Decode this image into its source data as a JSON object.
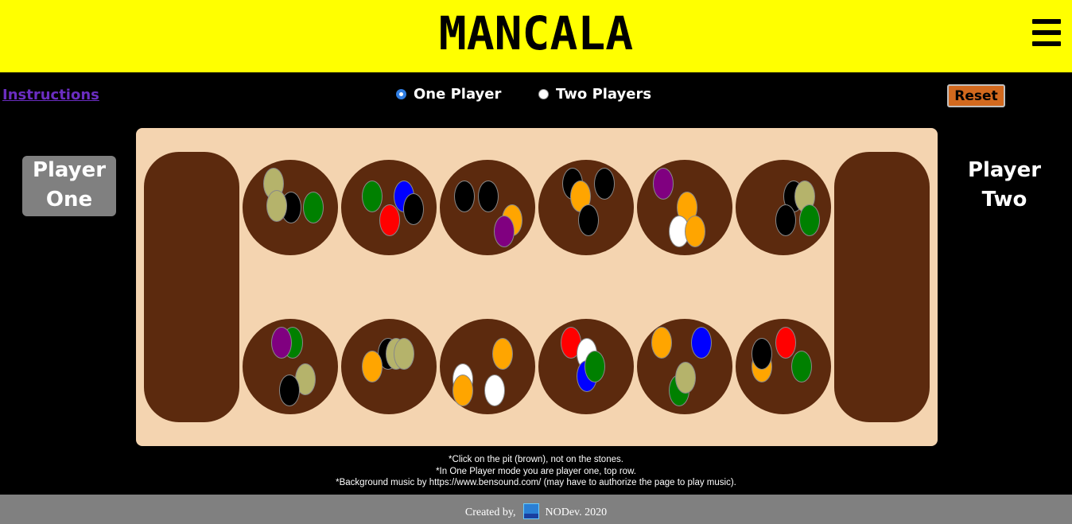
{
  "header": {
    "title": "MANCALA",
    "menu_icon": "hamburger-menu-icon",
    "background": "#ffff00"
  },
  "controls": {
    "instructions_label": "Instructions",
    "modes": [
      {
        "label": "One Player",
        "selected": true
      },
      {
        "label": "Two Players",
        "selected": false
      }
    ],
    "reset_label": "Reset"
  },
  "players": {
    "one": {
      "line1": "Player",
      "line2": "One",
      "active": true
    },
    "two": {
      "line1": "Player",
      "line2": "Two",
      "active": false
    }
  },
  "board": {
    "colors": {
      "board": "#f4d4b0",
      "pit": "#5c2a0e"
    },
    "top_row": [
      [
        "#b5b36b",
        "#000000",
        "#008000",
        "#b5b36b"
      ],
      [
        "#008000",
        "#0000ff",
        "#ff0000",
        "#000000"
      ],
      [
        "#000000",
        "#000000",
        "#ffa500",
        "#800080"
      ],
      [
        "#000000",
        "#000000",
        "#ffa500",
        "#000000"
      ],
      [
        "#800080",
        "#ffa500",
        "#ffffff",
        "#ffa500"
      ],
      [
        "#000000",
        "#b5b36b",
        "#000000",
        "#008000"
      ]
    ],
    "bottom_row": [
      [
        "#008000",
        "#800080",
        "#b5b36b",
        "#000000"
      ],
      [
        "#000000",
        "#b5b36b",
        "#b5b36b",
        "#ffa500"
      ],
      [
        "#ffa500",
        "#ffffff",
        "#ffa500",
        "#ffffff"
      ],
      [
        "#ff0000",
        "#ffffff",
        "#0000ff",
        "#008000"
      ],
      [
        "#ffa500",
        "#0000ff",
        "#008000",
        "#b5b36b"
      ],
      [
        "#ffa500",
        "#000000",
        "#ff0000",
        "#008000"
      ]
    ],
    "left_store": [],
    "right_store": []
  },
  "notes": [
    "*Click on the pit (brown), not on the stones.",
    "*In One Player mode you are player one, top row.",
    "*Background music by https://www.bensound.com/ (may have to authorize the page to play music)."
  ],
  "footer": {
    "created_by": "Created by,",
    "author": "NODev. 2020"
  }
}
